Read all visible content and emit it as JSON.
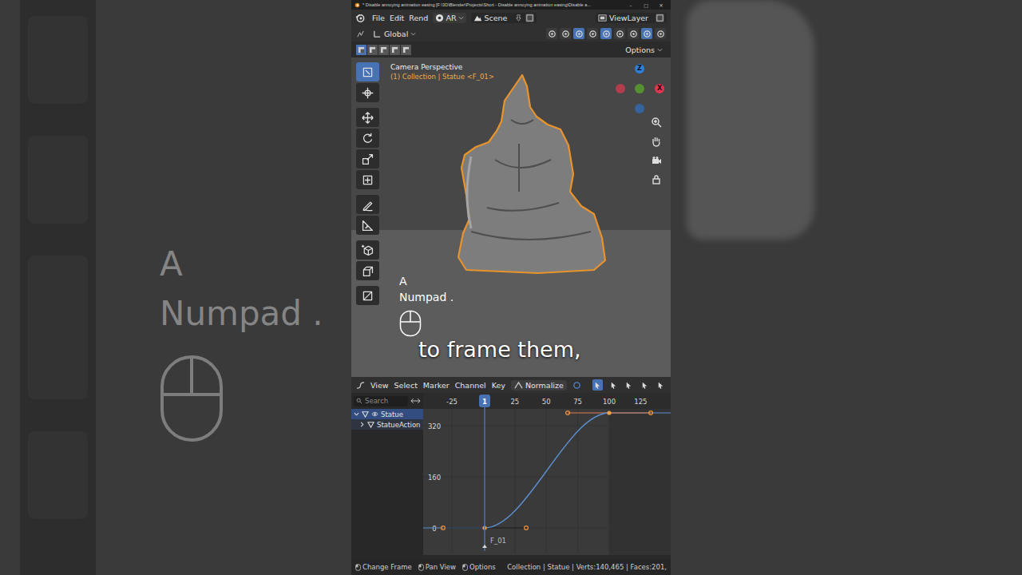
{
  "backdrop": {
    "key_hint": [
      "A",
      "Numpad ."
    ],
    "caption": "to frame them,"
  },
  "window": {
    "title": "* Disable annoying animation easing [F:\\3D\\Blender\\Projects\\Short - Disable annoying animation easing\\Disable a...",
    "controls": [
      "–",
      "□",
      "✕"
    ]
  },
  "menu": [
    "File",
    "Edit",
    "Rend"
  ],
  "workspace": "AR",
  "scene": "Scene",
  "view_layer": "ViewLayer",
  "viewport": {
    "orientation": "Global",
    "header_toggles": [
      {
        "selected": false
      },
      {
        "selected": false
      },
      {
        "selected": true
      },
      {
        "selected": false
      },
      {
        "selected": true
      },
      {
        "selected": false
      },
      {
        "selected": false
      },
      {
        "selected": true
      },
      {
        "selected": false
      }
    ],
    "select_modes": [
      {
        "selected": true
      },
      {
        "selected": false
      },
      {
        "selected": false
      },
      {
        "selected": false
      },
      {
        "selected": false
      }
    ],
    "options": "Options",
    "view_name": "Camera Perspective",
    "context": "(1) Collection | Statue <F_01>",
    "gizmo": [
      {
        "label": "Z",
        "color": "#2f7fd8"
      },
      {
        "label": "",
        "color": "#d5394f"
      },
      {
        "label": "",
        "color": "#5aa82c"
      },
      {
        "label": "X",
        "color": "#e23650"
      },
      {
        "label": "",
        "color": "#2f6cb8"
      }
    ],
    "key_overlay": [
      "A",
      "Numpad ."
    ],
    "caption": "to frame them,",
    "tools": [
      {
        "kind": "select",
        "selected": true
      },
      {
        "kind": "cursor",
        "selected": false
      },
      {
        "kind": "move",
        "selected": false
      },
      {
        "kind": "rotate",
        "selected": false
      },
      {
        "kind": "scale",
        "selected": false
      },
      {
        "kind": "transform",
        "selected": false
      },
      {
        "kind": "annotate",
        "selected": false
      },
      {
        "kind": "measure",
        "selected": false
      },
      {
        "kind": "add-cube",
        "selected": false
      },
      {
        "kind": "extrude",
        "selected": false
      },
      {
        "kind": "shade",
        "selected": false
      }
    ]
  },
  "graph_editor": {
    "menu": [
      "View",
      "Select",
      "Marker",
      "Channel",
      "Key"
    ],
    "normalize": {
      "label": "Normalize",
      "selected": false
    },
    "header_toggles": [
      {
        "selected": true
      },
      {
        "selected": false
      },
      {
        "selected": false
      },
      {
        "selected": false
      },
      {
        "selected": false
      }
    ],
    "search": {
      "placeholder": "Search"
    },
    "channels": [
      {
        "label": "Statue",
        "selected": true,
        "expanded": true
      },
      {
        "label": "StatueAction",
        "selected": false,
        "expanded": false
      }
    ],
    "current_frame": "1",
    "ruler": [
      "-25",
      "25",
      "50",
      "75",
      "100",
      "125"
    ],
    "y_ticks": [
      "320",
      "160",
      "0"
    ],
    "frame_range": [
      1,
      100
    ],
    "curve": {
      "frames": [
        1,
        100
      ],
      "values": [
        0,
        360
      ],
      "handles": [
        [
          -32,
          0,
          34,
          0
        ],
        [
          67,
          360,
          133,
          360
        ]
      ]
    },
    "marker": "F_01"
  },
  "status_bar": {
    "hints": [
      "Change Frame",
      "Pan View",
      "Options"
    ],
    "info": "Collection | Statue | Verts:140,465 | Faces:201,"
  }
}
